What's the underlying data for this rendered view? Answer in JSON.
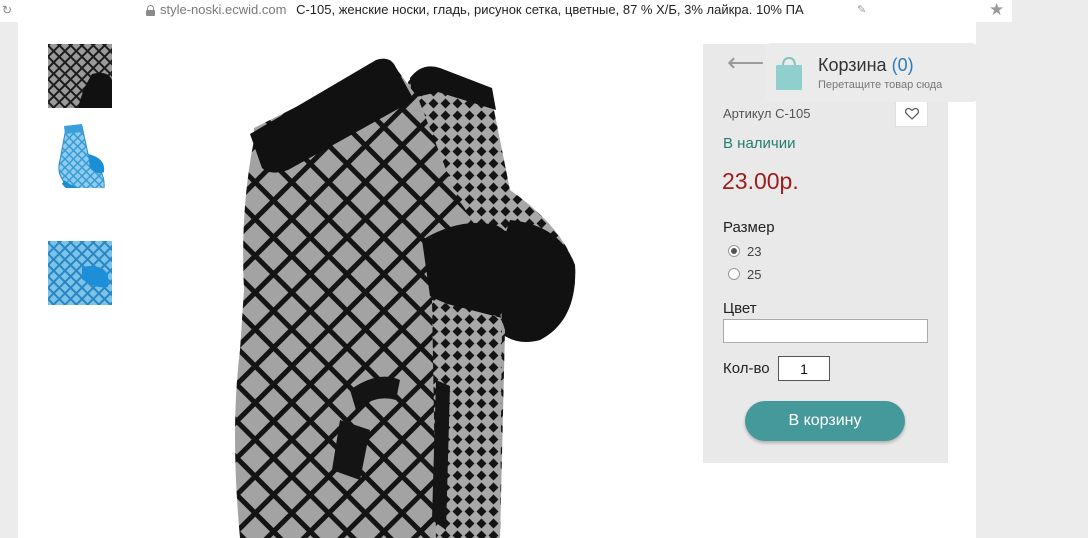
{
  "browser": {
    "domain": "style-noski.ecwid.com",
    "page_title": "С-105, женские носки, гладь, рисунок сетка, цветные, 87 % Х/Б, 3% лайкра. 10% ПА"
  },
  "product": {
    "sku": "Артикул С-105",
    "stock_status": "В наличии",
    "price": "23.00р.",
    "size_label": "Размер",
    "size_options": [
      {
        "label": "23",
        "selected": true
      },
      {
        "label": "25",
        "selected": false
      }
    ],
    "color_label": "Цвет",
    "color_value": "",
    "qty_label": "Кол-во",
    "qty_value": "1",
    "add_to_cart_label": "В корзину"
  },
  "minicart": {
    "title": "Корзина",
    "count": "(0)",
    "hint": "Перетащите товар сюда"
  },
  "colors": {
    "price": "#9e1c1c",
    "in_stock": "#257d70",
    "button": "#45999b",
    "cart_count": "#2b7bbf"
  }
}
